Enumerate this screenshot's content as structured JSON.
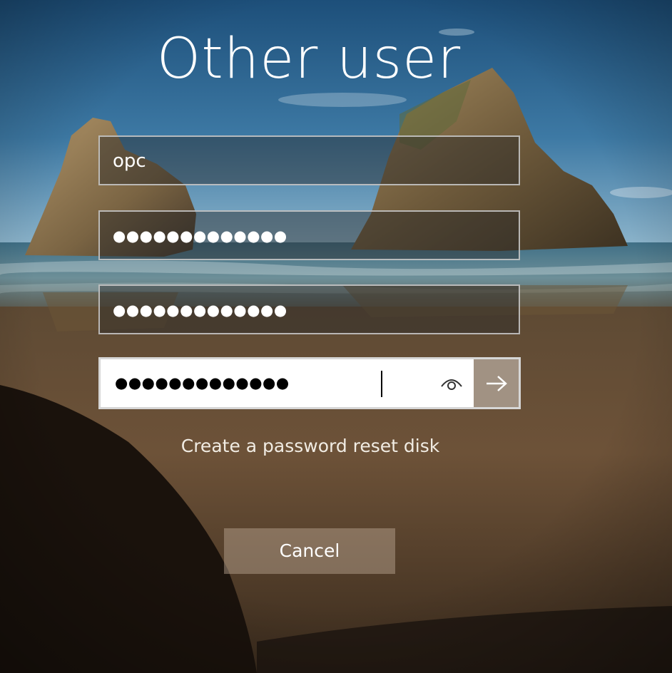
{
  "title": "Other user",
  "username_field": {
    "value": "opc"
  },
  "password_field_1": {
    "masked_value": "●●●●●●●●●●●●●"
  },
  "password_field_2": {
    "masked_value": "●●●●●●●●●●●●●"
  },
  "password_field_3": {
    "masked_value": "●●●●●●●●●●●●●",
    "reveal_icon": "eye-icon",
    "submit_icon": "arrow-right-icon"
  },
  "reset_link": "Create a password reset disk",
  "cancel_label": "Cancel",
  "colors": {
    "text": "#ffffff",
    "field_border": "#cdcdcd",
    "active_field_bg": "#ffffff"
  }
}
